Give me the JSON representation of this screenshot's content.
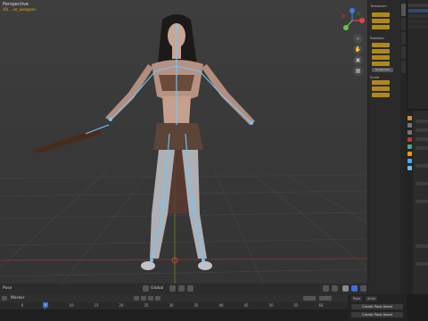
{
  "viewport": {
    "mode_label": "Perspective",
    "object_label": "(0) …er_weapon",
    "gizmo_axes": [
      "X",
      "Y",
      "Z"
    ],
    "nav_buttons": [
      "zoom-icon",
      "hand-icon",
      "camera-icon",
      "grid-icon"
    ]
  },
  "npanel": {
    "section_transform": "Transform",
    "section_rotation": "Rotation",
    "section_scale": "Scale",
    "rotation_mode": "Quaternion",
    "location_fields": [
      "…",
      "…",
      "…"
    ],
    "rotation_fields": [
      "…",
      "…",
      "…",
      "…"
    ],
    "scale_fields": [
      "…",
      "…",
      "…"
    ]
  },
  "footer": {
    "global_label": "Global",
    "left_label": "Pose"
  },
  "timeline": {
    "header_items": [
      "Playback",
      "Keying",
      "View",
      "Marker"
    ],
    "marker_label": "Marker",
    "frames": [
      "0",
      "5",
      "10",
      "15",
      "20",
      "25",
      "30",
      "35",
      "40",
      "45",
      "50",
      "55",
      "60"
    ],
    "current_frame": "0"
  },
  "pose_panel": {
    "tabs": [
      "Pose",
      "Anim"
    ],
    "create_pose_asset": "Create Pose Asset",
    "create_pose_asset_btn": "Create Pose Asset"
  },
  "colors": {
    "accent": "#e8b500",
    "playhead": "#3b6fd6",
    "bone": "#6fc8ff"
  }
}
